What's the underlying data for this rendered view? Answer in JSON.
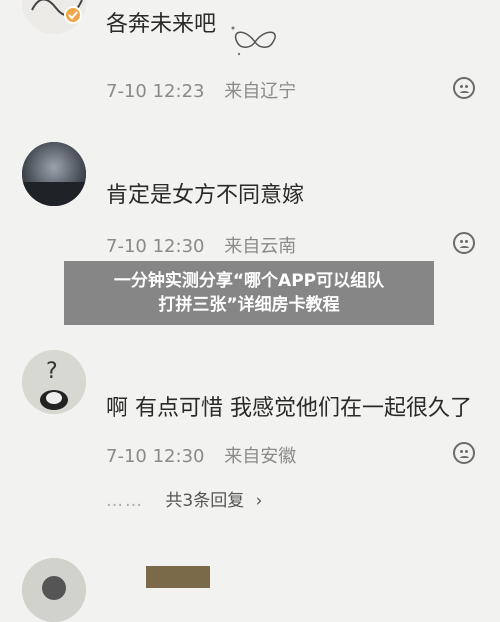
{
  "comments": [
    {
      "text": "各奔未来吧",
      "date": "7-10",
      "time": "12:23",
      "location": "来自辽宁",
      "reaction_icon": "sad-face-icon"
    },
    {
      "name": "",
      "text": "肯定是女方不同意嫁",
      "date": "7-10",
      "time": "12:30",
      "location": "来自云南",
      "reaction_icon": "sad-face-icon"
    },
    {
      "text": "啊 有点可惜 我感觉他们在一起很久了",
      "date": "7-10",
      "time": "12:30",
      "location": "来自安徽",
      "reaction_icon": "sad-face-icon",
      "replies": "共3条回复",
      "replies_arrow": "›"
    }
  ],
  "banner": {
    "line1": "一分钟实测分享“哪个APP可以组队",
    "line2": "打拼三张”详细房卡教程"
  },
  "colors": {
    "background": "#f2f2f0",
    "banner": "#6e6e6e",
    "verified_badge": "#f0a64a"
  }
}
